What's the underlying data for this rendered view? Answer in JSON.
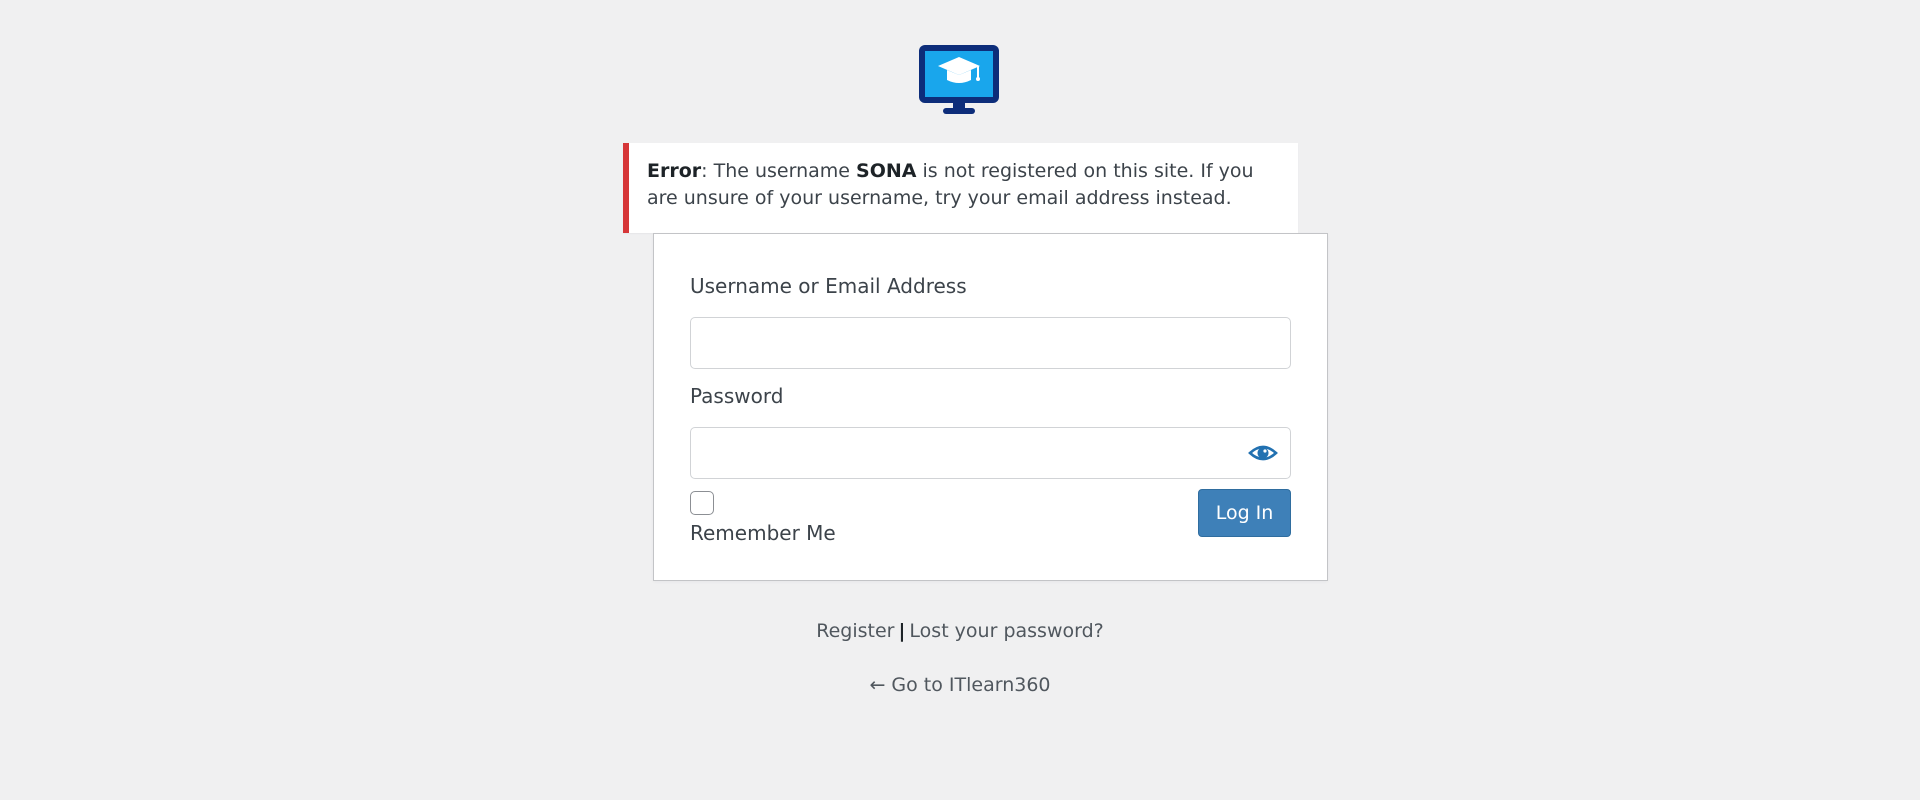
{
  "logo": {
    "icon": "monitor-graduation-cap-icon"
  },
  "error": {
    "prefix": "Error",
    "text_before": ": The username ",
    "username": "SONA",
    "text_after": " is not registered on this site. If you are unsure of your username, try your email address instead."
  },
  "form": {
    "username_label": "Username or Email Address",
    "username_value": "",
    "password_label": "Password",
    "password_value": "",
    "remember_label": "Remember Me",
    "login_label": "Log In"
  },
  "links": {
    "register": "Register",
    "separator": "|",
    "lost_password": "Lost your password?",
    "back": "← Go to ITlearn360"
  },
  "colors": {
    "error_border": "#d63638",
    "primary_button": "#3e80b8",
    "eye_icon": "#2271b1"
  }
}
